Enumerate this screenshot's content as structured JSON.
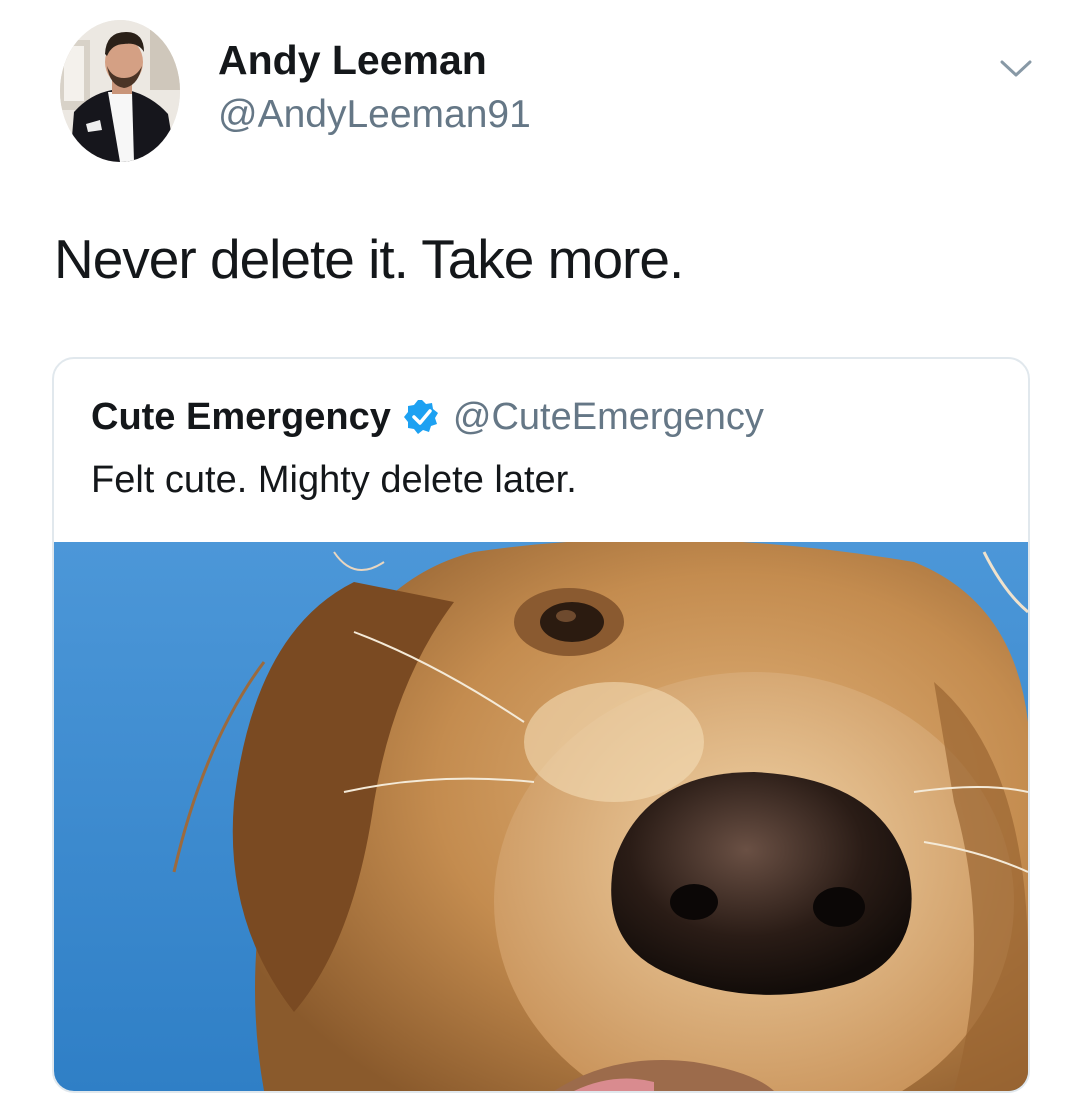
{
  "tweet": {
    "author": {
      "name": "Andy Leeman",
      "handle": "@AndyLeeman91",
      "avatar_icon": "profile-photo"
    },
    "menu_icon": "chevron-down-icon",
    "text": "Never delete it. Take more."
  },
  "quoted_tweet": {
    "author": {
      "name": "Cute Emergency",
      "verified": true,
      "verified_icon": "verified-badge-icon",
      "handle": "@CuteEmergency"
    },
    "text": "Felt cute. Mighty delete later.",
    "media": {
      "subject": "dog-selfie-photo"
    }
  },
  "colors": {
    "text_primary": "#14171a",
    "text_secondary": "#657786",
    "border": "#e1e8ed",
    "verified_blue": "#1da1f2",
    "sky_blue": "#3f8fd4"
  }
}
